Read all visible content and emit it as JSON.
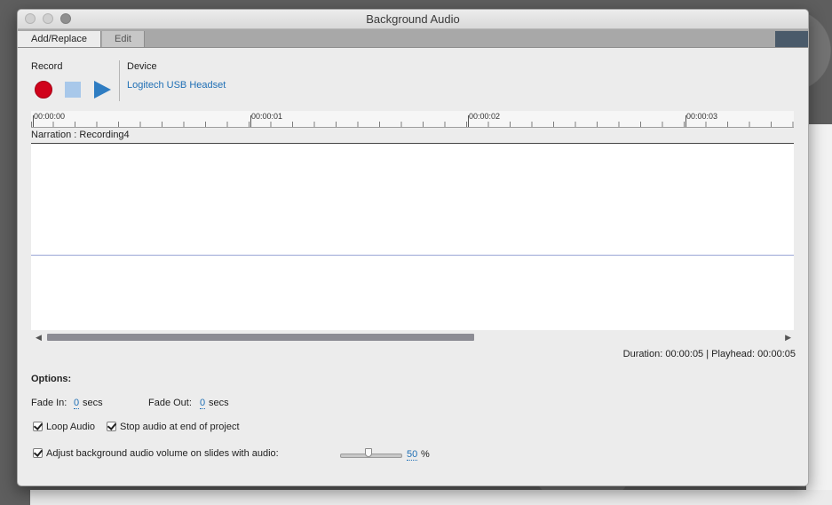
{
  "window": {
    "title": "Background Audio"
  },
  "tabs": [
    {
      "label": "Add/Replace",
      "active": true
    },
    {
      "label": "Edit",
      "active": false
    }
  ],
  "record": {
    "label": "Record"
  },
  "device": {
    "label": "Device",
    "value": "Logitech USB Headset"
  },
  "timeline": {
    "ticks": [
      "00:00:00",
      "00:00:01",
      "00:00:02",
      "00:00:03"
    ],
    "track_label": "Narration : Recording4"
  },
  "status": {
    "duration_label": "Duration:",
    "duration_value": "00:00:05",
    "separator": "|",
    "playhead_label": "Playhead:",
    "playhead_value": "00:00:05"
  },
  "options": {
    "title": "Options:",
    "fade_in_label": "Fade In:",
    "fade_in_value": "0",
    "fade_in_unit": "secs",
    "fade_out_label": "Fade Out:",
    "fade_out_value": "0",
    "fade_out_unit": "secs",
    "loop_audio_label": "Loop Audio",
    "loop_audio_checked": true,
    "stop_audio_label": "Stop audio at end of project",
    "stop_audio_checked": true,
    "adjust_volume_label": "Adjust background audio volume on slides with audio:",
    "adjust_volume_checked": true,
    "volume_value": "50",
    "volume_unit": "%",
    "volume_level_percent": 50
  },
  "colors": {
    "record": "#d0021b",
    "stop": "#a8c8ea",
    "play": "#2f7dc2",
    "link": "#1f6fb5",
    "waveform": "#9aa6d6"
  }
}
